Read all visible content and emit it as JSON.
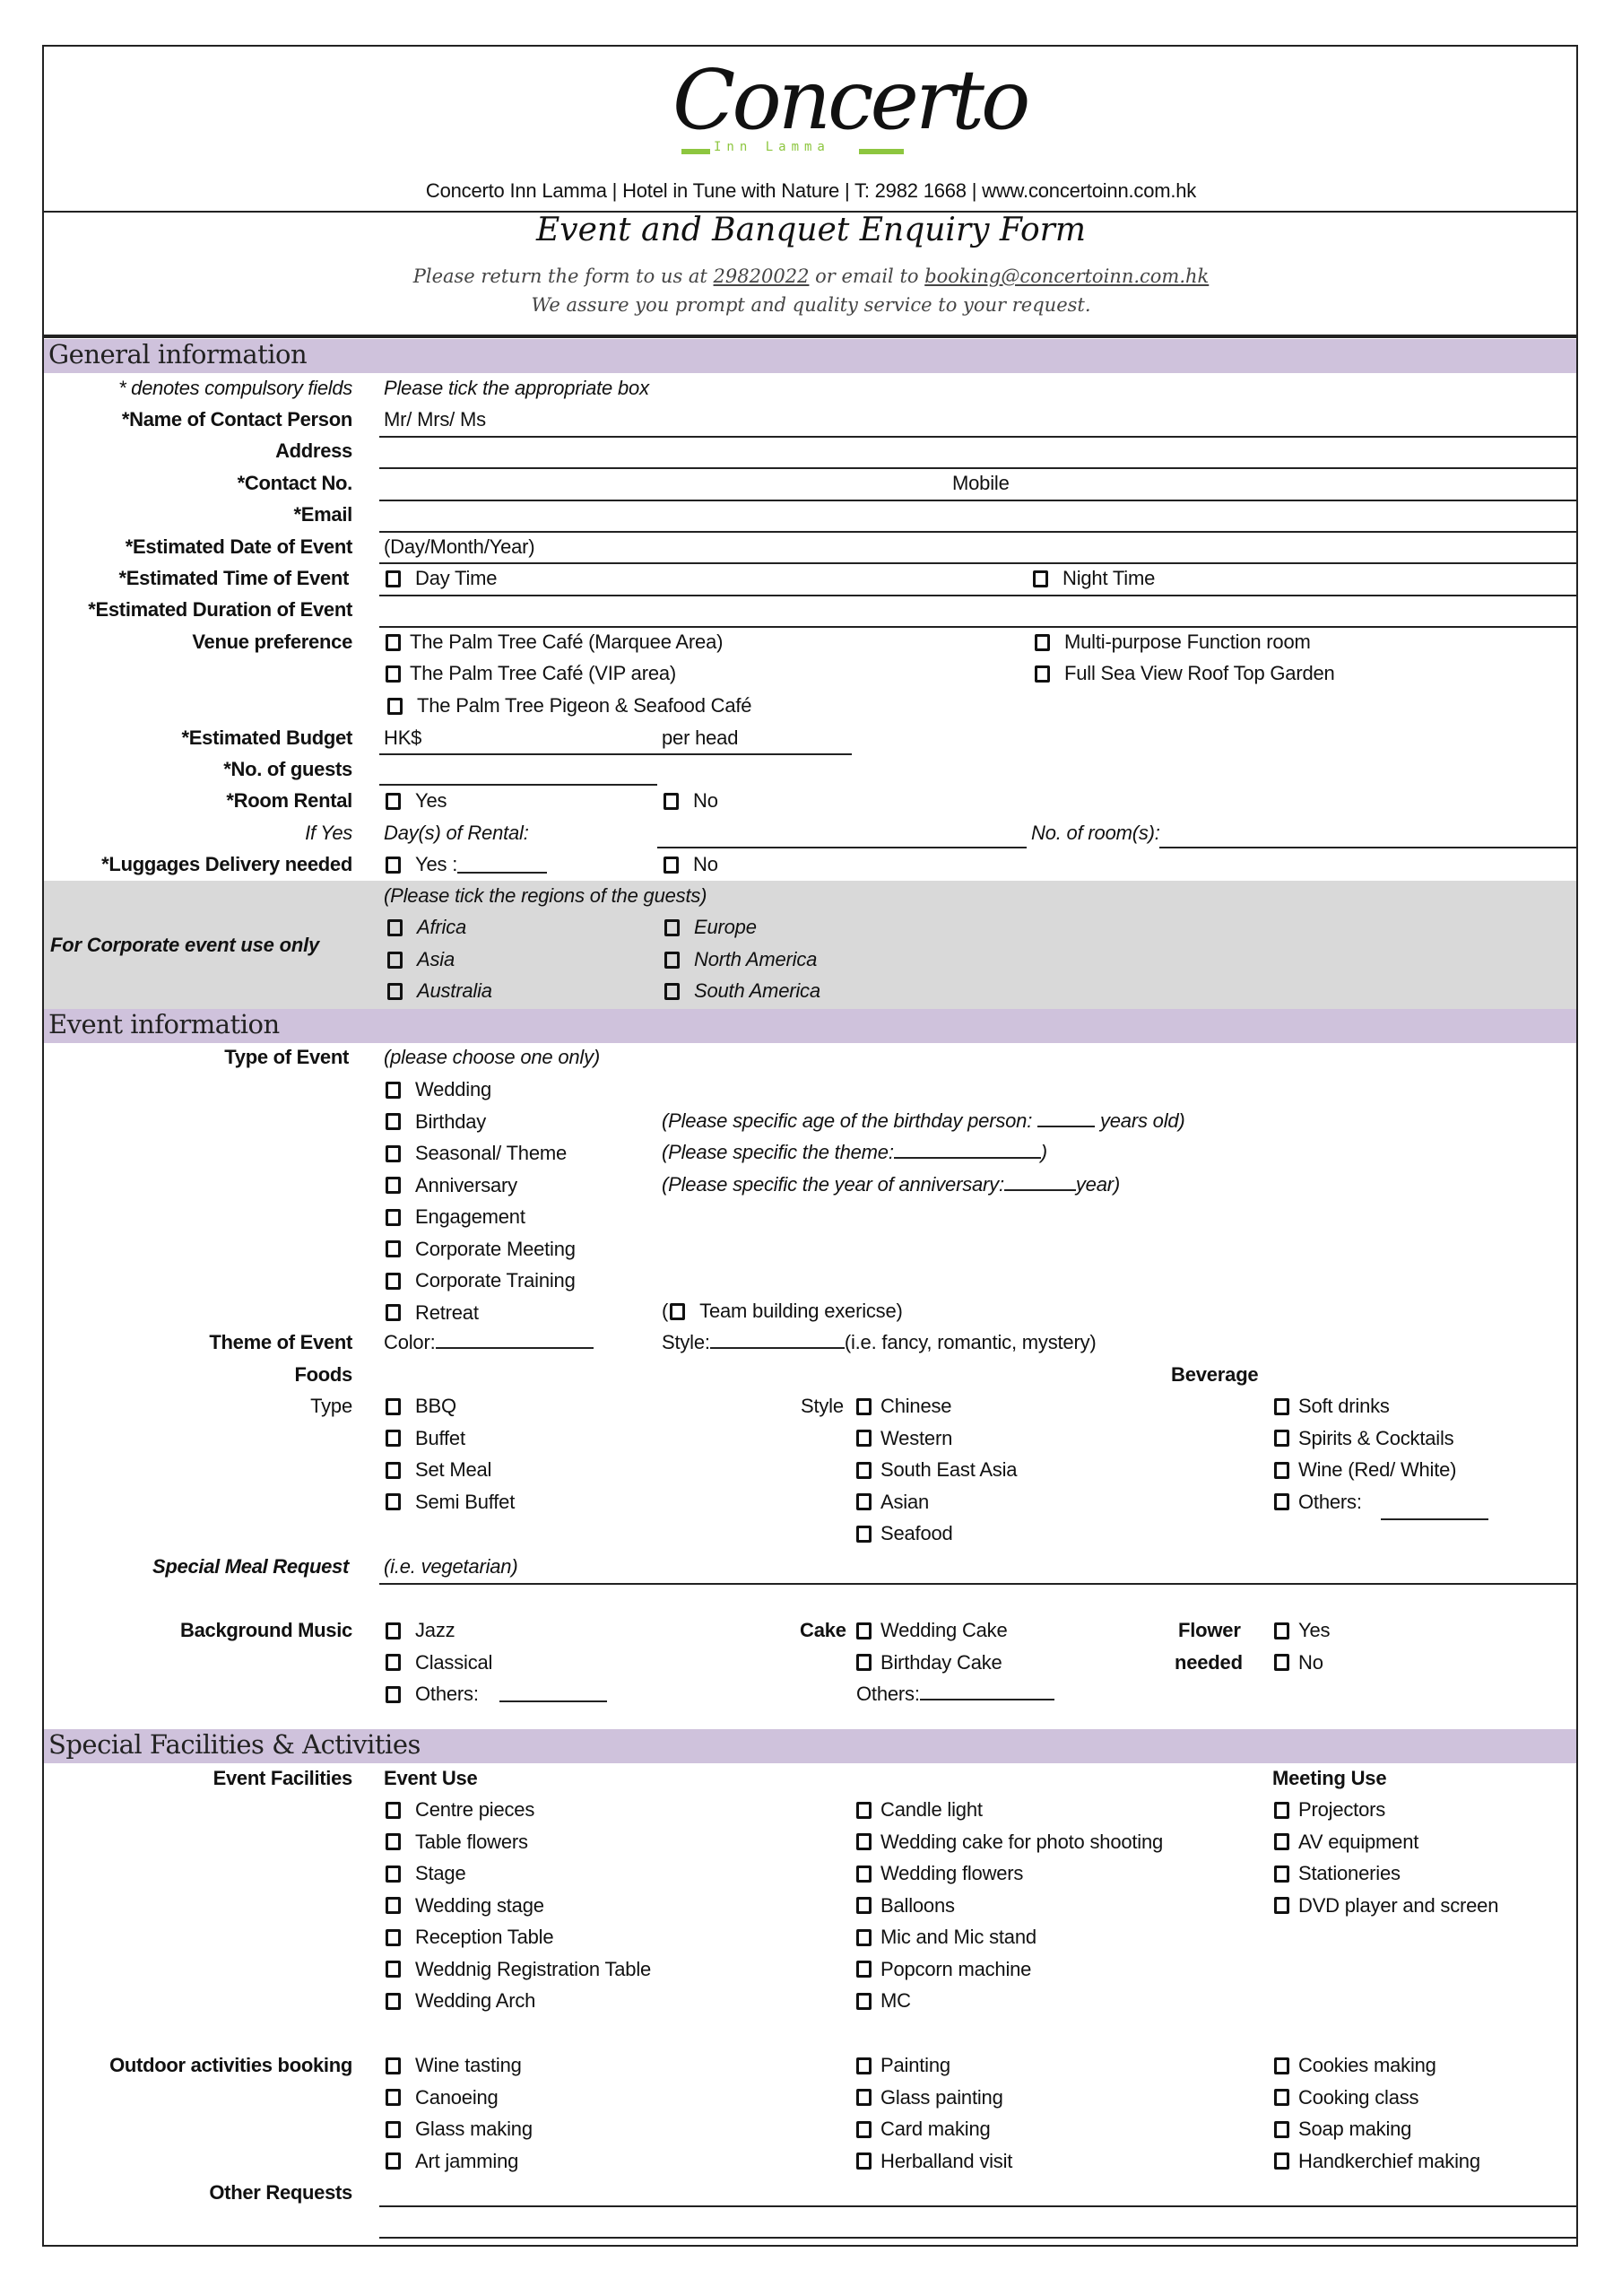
{
  "header": {
    "logo_text": "Concerto",
    "logo_subtext": "Inn  Lamma",
    "contact_line": "Concerto Inn Lamma | Hotel in Tune with Nature | T: 2982 1668 | www.concertoinn.com.hk",
    "form_title": "Event and Banquet Enquiry Form",
    "instruction_prefix": "Please return the form to us at ",
    "fax_number": "29820022",
    "instruction_middle": " or email to ",
    "email": "booking@concertoinn.com.hk",
    "assurance": "We assure you prompt and quality service to your request.",
    "logo_accent_color": "#8dc63f"
  },
  "colors": {
    "section_band": "#cfc2dc",
    "corporate_band": "#d9d9d9"
  },
  "general": {
    "section_title": "General information",
    "compulsory_note": "* denotes compulsory fields",
    "tick_note": "Please tick the appropriate box",
    "name_label": "*Name of Contact Person",
    "name_prefix": "Mr/ Mrs/ Ms",
    "address_label": "Address",
    "contact_label": "*Contact No.",
    "mobile_label": "Mobile",
    "email_label": "*Email",
    "date_label": "*Estimated Date of Event",
    "date_hint": "(Day/Month/Year)",
    "time_label": "*Estimated Time of Event",
    "time_options": [
      "Day Time",
      "Night Time"
    ],
    "duration_label": "*Estimated Duration of Event",
    "venue_label": "Venue preference",
    "venue_options": [
      "The Palm Tree Café (Marquee Area)",
      "The Palm Tree Café (VIP area)",
      "The Palm Tree Pigeon & Seafood Café",
      "Multi-purpose Function room",
      "Full Sea View Roof Top Garden"
    ],
    "budget_label": "*Estimated Budget",
    "budget_currency": "HK$",
    "budget_unit": "per head",
    "guests_label": "*No. of guests",
    "room_label": "*Room Rental",
    "room_options": [
      "Yes",
      "No"
    ],
    "ifyes_label": "If Yes",
    "days_rental": "Day(s) of Rental:",
    "rooms_count": "No. of room(s):",
    "luggage_label": "*Luggages Delivery needed",
    "luggage_yes": "Yes :",
    "luggage_no": "No",
    "corporate_label": "For Corporate event use only",
    "regions_note": "(Please tick the regions of the guests)",
    "regions": [
      "Africa",
      "Asia",
      "Australia",
      "Europe",
      "North America",
      "South America"
    ]
  },
  "event": {
    "section_title": "Event information",
    "type_label": "Type of Event",
    "type_note": "(please choose one only)",
    "types": [
      "Wedding",
      "Birthday",
      "Seasonal/ Theme",
      "Anniversary",
      "Engagement",
      "Corporate Meeting",
      "Corporate Training",
      "Retreat"
    ],
    "birthday_note": "(Please specific age of the birthday person: ",
    "birthday_note_end": " years old)",
    "theme_note": "(Please specific the theme:",
    "theme_note_end": ")",
    "anniversary_note": "(Please specific the year of anniversary:",
    "anniversary_note_end": "year)",
    "team_building": "Team building exericse)",
    "team_building_open": "(",
    "theme_label": "Theme of Event",
    "color_label": "Color:",
    "style_label": "Style:",
    "style_hint": "(i.e. fancy, romantic, mystery)",
    "foods_label": "Foods",
    "beverage_label": "Beverage",
    "food_type_label": "Type",
    "food_types": [
      "BBQ",
      "Buffet",
      "Set Meal",
      "Semi Buffet"
    ],
    "food_style_label": "Style",
    "food_styles": [
      "Chinese",
      "Western",
      "South East Asia",
      "Asian",
      "Seafood"
    ],
    "beverages": [
      "Soft drinks",
      "Spirits & Cocktails",
      "Wine (Red/ White)",
      "Others:"
    ],
    "special_meal_label": "Special Meal Request",
    "special_meal_hint": "(i.e. vegetarian)",
    "music_label": "Background Music",
    "music_options": [
      "Jazz",
      "Classical",
      "Others:"
    ],
    "cake_label": "Cake",
    "cake_options": [
      "Wedding Cake",
      "Birthday Cake"
    ],
    "cake_others": "Others:",
    "flower_label_1": "Flower",
    "flower_label_2": "needed",
    "flower_options": [
      "Yes",
      "No"
    ]
  },
  "facilities": {
    "section_title": "Special Facilities & Activities",
    "facilities_label": "Event Facilities",
    "event_use_label": "Event Use",
    "event_use_col1": [
      "Centre pieces",
      "Table flowers",
      "Stage",
      "Wedding stage",
      "Reception Table",
      "Weddnig Registration Table",
      "Wedding Arch"
    ],
    "event_use_col2": [
      "Candle light",
      "Wedding cake for photo shooting",
      "Wedding flowers",
      "Balloons",
      "Mic and Mic stand",
      "Popcorn machine",
      "MC"
    ],
    "meeting_use_label": "Meeting Use",
    "meeting_use": [
      "Projectors",
      "AV equipment",
      "Stationeries",
      "DVD player and screen"
    ],
    "outdoor_label": "Outdoor activities booking",
    "outdoor_col1": [
      "Wine tasting",
      "Canoeing",
      "Glass making",
      "Art jamming"
    ],
    "outdoor_col2": [
      "Painting",
      "Glass painting",
      "Card making",
      "Herballand visit"
    ],
    "outdoor_col3": [
      "Cookies making",
      "Cooking class",
      "Soap making",
      "Handkerchief making"
    ],
    "other_requests_label": "Other Requests"
  }
}
